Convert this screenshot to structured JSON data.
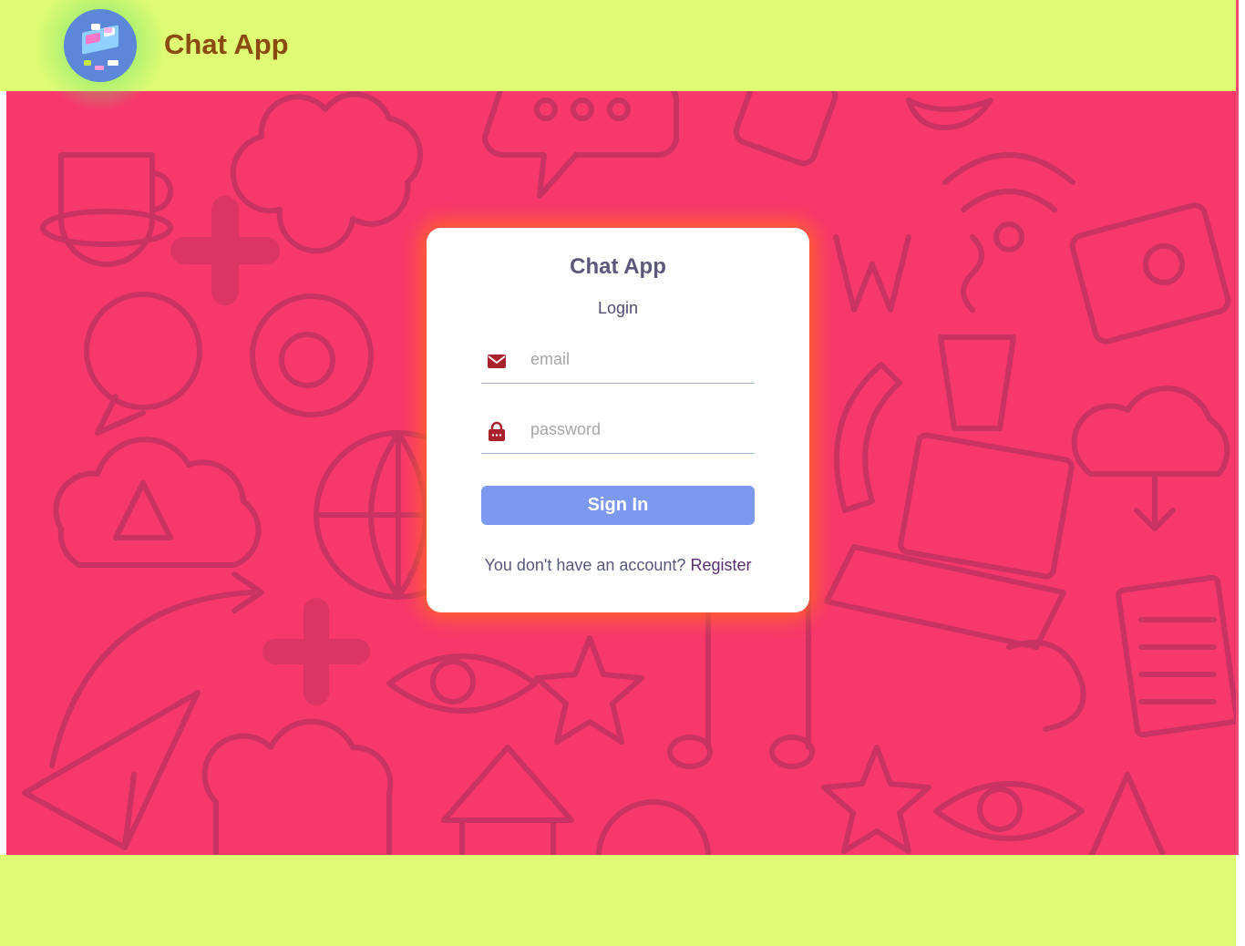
{
  "header": {
    "app_title": "Chat App",
    "logo_icon": "chat-app-logo-icon"
  },
  "login_card": {
    "title": "Chat App",
    "subtitle": "Login",
    "email": {
      "placeholder": "email",
      "value": "",
      "icon": "envelope-icon"
    },
    "password": {
      "placeholder": "password",
      "value": "",
      "icon": "lock-icon"
    },
    "signin_label": "Sign In",
    "register_prompt": "You don't have an account?",
    "register_link": "Register"
  },
  "colors": {
    "header_bg": "#dffb74",
    "stage_bg": "#f7386d",
    "title_color": "#8a4b10",
    "button_bg": "#7d98ef",
    "icon_color": "#a8222e",
    "card_glow": "#ff6428"
  },
  "background_pattern": "doodle-pattern"
}
